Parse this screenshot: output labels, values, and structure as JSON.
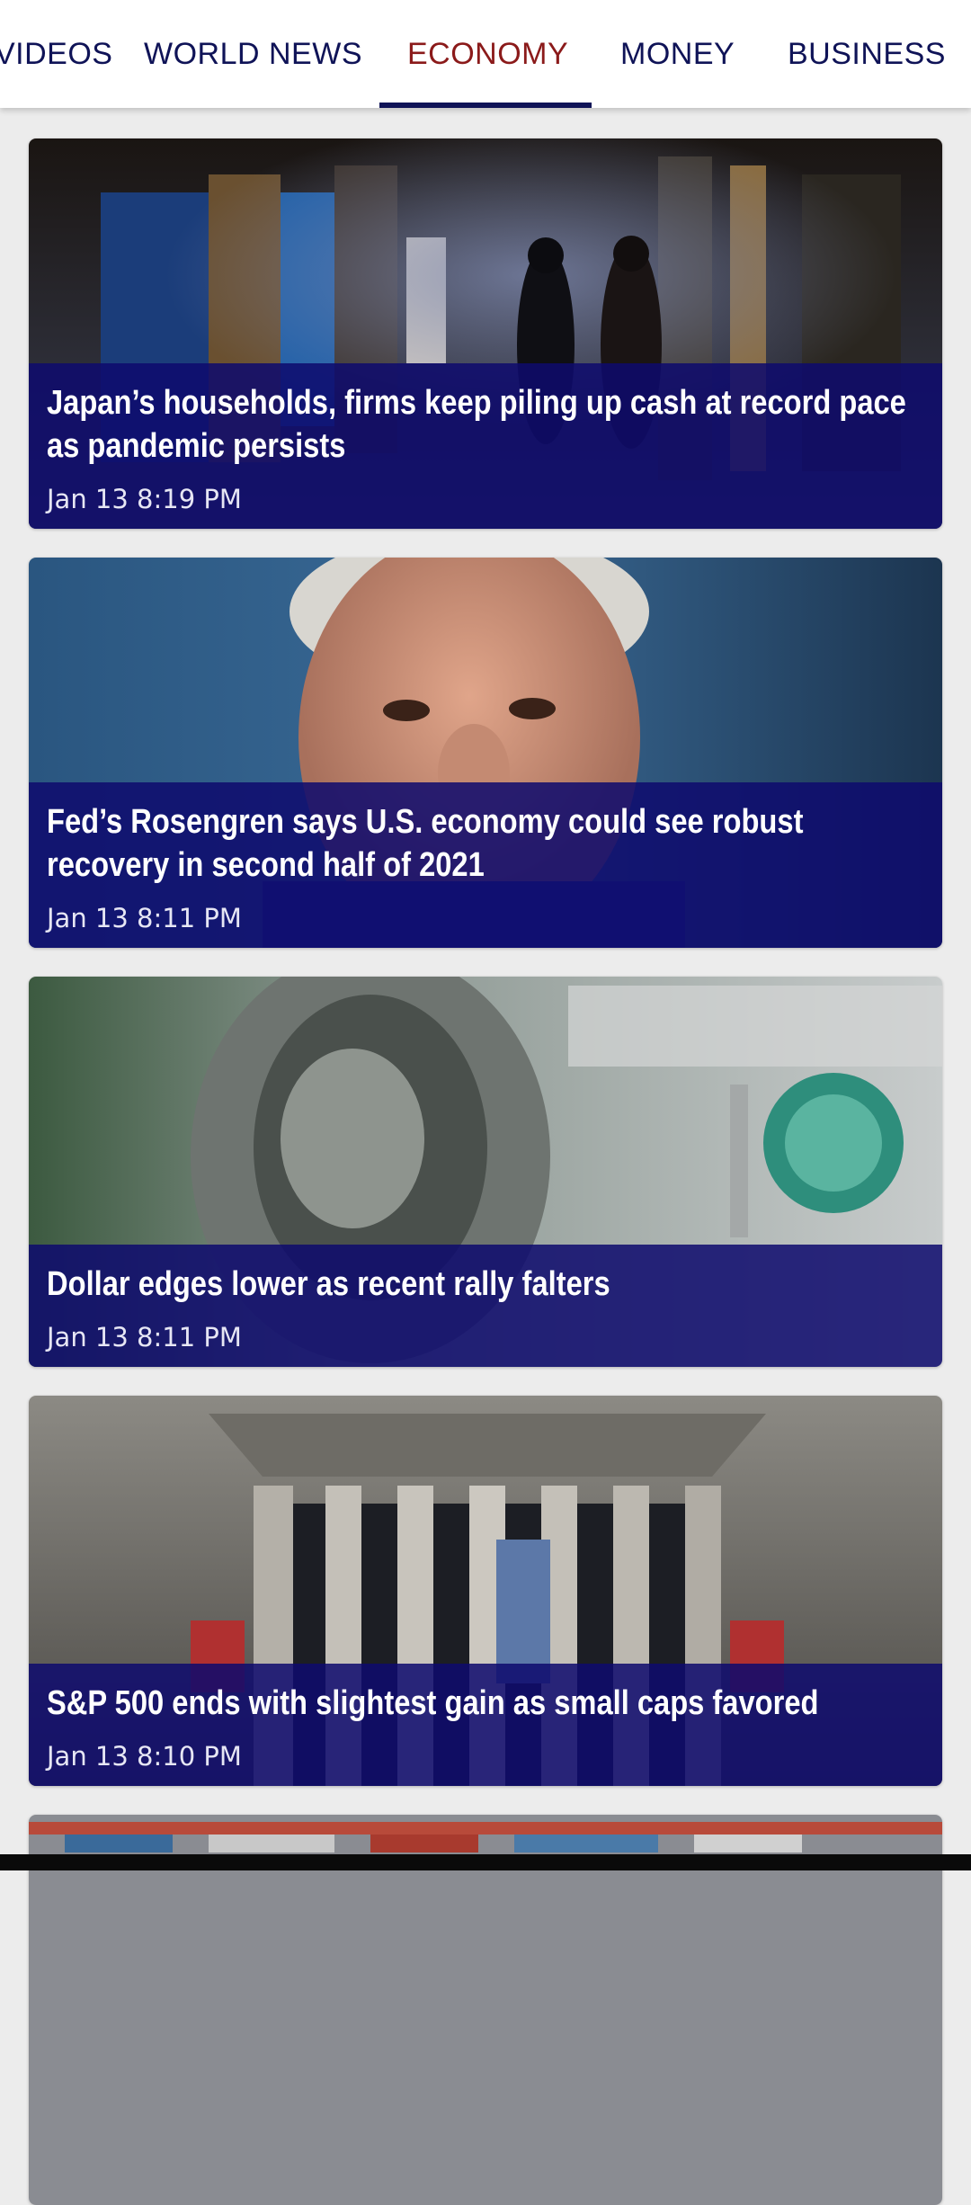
{
  "tabs": [
    {
      "label": "VIDEOS"
    },
    {
      "label": "WORLD NEWS"
    },
    {
      "label": "ECONOMY"
    },
    {
      "label": "MONEY"
    },
    {
      "label": "BUSINESS"
    }
  ],
  "active_tab": "ECONOMY",
  "colors": {
    "tab_text": "#0f1357",
    "tab_active": "#8b1a1a",
    "caption_overlay": "#0e0a6e"
  },
  "articles": [
    {
      "headline": "Japan’s households, firms keep piling up cash at record pace as pandemic persists",
      "time": "Jan 13 8:19 PM",
      "image": "night-alley-photo"
    },
    {
      "headline": "Fed’s Rosengren says U.S. economy could see robust recovery in second half of 2021",
      "time": "Jan 13 8:11 PM",
      "image": "speaker-portrait-photo"
    },
    {
      "headline": "Dollar edges lower as recent rally falters",
      "time": "Jan 13 8:11 PM",
      "image": "hundred-dollar-bill-photo"
    },
    {
      "headline": "S&P 500 ends with slightest gain as small caps favored",
      "time": "Jan 13 8:10 PM",
      "image": "stock-exchange-building-photo"
    },
    {
      "headline": "",
      "time": "",
      "image": "shipping-containers-photo"
    }
  ]
}
